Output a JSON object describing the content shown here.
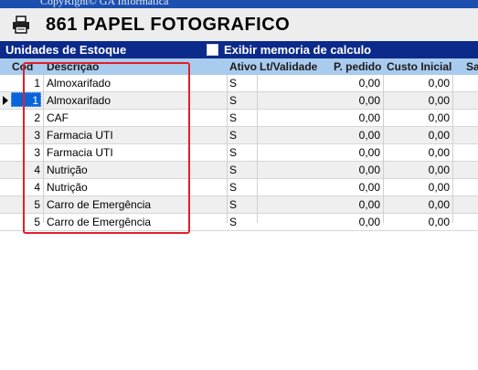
{
  "window": {
    "copyright": "CopyRight© GA Informática"
  },
  "header": {
    "product_title": "861 PAPEL FOTOGRAFICO"
  },
  "stock_bar": {
    "label": "Unidades de Estoque",
    "checkbox_label": "Exibir memoria de calculo"
  },
  "columns": {
    "cod": "Cod",
    "descricao": "Descrição",
    "ativo": "Ativo",
    "lt_validade": "Lt/Validade",
    "p_pedido": "P. pedido",
    "custo_inicial": "Custo Inicial",
    "sa": "Sa"
  },
  "rows": [
    {
      "cod": "1",
      "descricao": "Almoxarifado",
      "ativo": "S",
      "lt_validade": "",
      "p_pedido": "0,00",
      "custo_inicial": "0,00"
    },
    {
      "cod": "1",
      "descricao": "Almoxarifado",
      "ativo": "S",
      "lt_validade": "",
      "p_pedido": "0,00",
      "custo_inicial": "0,00"
    },
    {
      "cod": "2",
      "descricao": "CAF",
      "ativo": "S",
      "lt_validade": "",
      "p_pedido": "0,00",
      "custo_inicial": "0,00"
    },
    {
      "cod": "3",
      "descricao": "Farmacia UTI",
      "ativo": "S",
      "lt_validade": "",
      "p_pedido": "0,00",
      "custo_inicial": "0,00"
    },
    {
      "cod": "3",
      "descricao": "Farmacia UTI",
      "ativo": "S",
      "lt_validade": "",
      "p_pedido": "0,00",
      "custo_inicial": "0,00"
    },
    {
      "cod": "4",
      "descricao": "Nutrição",
      "ativo": "S",
      "lt_validade": "",
      "p_pedido": "0,00",
      "custo_inicial": "0,00"
    },
    {
      "cod": "4",
      "descricao": "Nutrição",
      "ativo": "S",
      "lt_validade": "",
      "p_pedido": "0,00",
      "custo_inicial": "0,00"
    },
    {
      "cod": "5",
      "descricao": "Carro de Emergência",
      "ativo": "S",
      "lt_validade": "",
      "p_pedido": "0,00",
      "custo_inicial": "0,00"
    },
    {
      "cod": "5",
      "descricao": "Carro de Emergência",
      "ativo": "S",
      "lt_validade": "",
      "p_pedido": "0,00",
      "custo_inicial": "0,00"
    }
  ],
  "selected_row": 1,
  "icons": {
    "printer": "printer-icon",
    "row_pointer": "row-pointer-icon"
  },
  "colors": {
    "header_bar": "#0b2a8a",
    "grid_header": "#a9cbee",
    "selection": "#0a64d8",
    "highlight_box": "#e0202a"
  }
}
